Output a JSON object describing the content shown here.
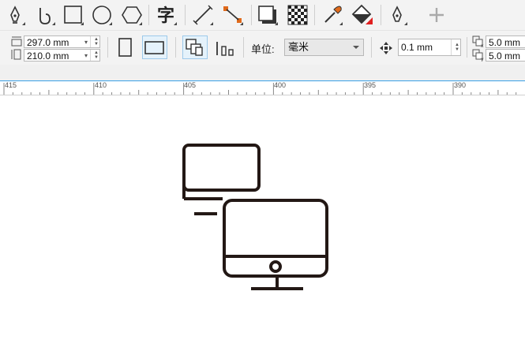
{
  "property_bar": {
    "page_width": "297.0 mm",
    "page_height": "210.0 mm",
    "unit_label": "单位:",
    "unit_value": "毫米",
    "nudge": "0.1 mm",
    "dup_x": "5.0 mm",
    "dup_y": "5.0 mm"
  },
  "ruler": {
    "ticks": [
      "415",
      "410",
      "405",
      "400",
      "395",
      "390"
    ]
  },
  "toolbar_icons": [
    "pen-icon",
    "curve-icon",
    "rectangle-icon",
    "ellipse-icon",
    "polygon-icon",
    "text-icon",
    "line-icon",
    "connector-icon",
    "drop-shadow-icon",
    "transparency-icon",
    "eyedropper-icon",
    "fill-icon",
    "pen-outline-icon",
    "add-icon"
  ],
  "colors": {
    "toolbar_bg": "#f3f3f3",
    "accent": "#3aa0e6",
    "icon_stroke": "#231815",
    "connector_orange": "#e06a1b",
    "fill_red": "#e02020"
  }
}
